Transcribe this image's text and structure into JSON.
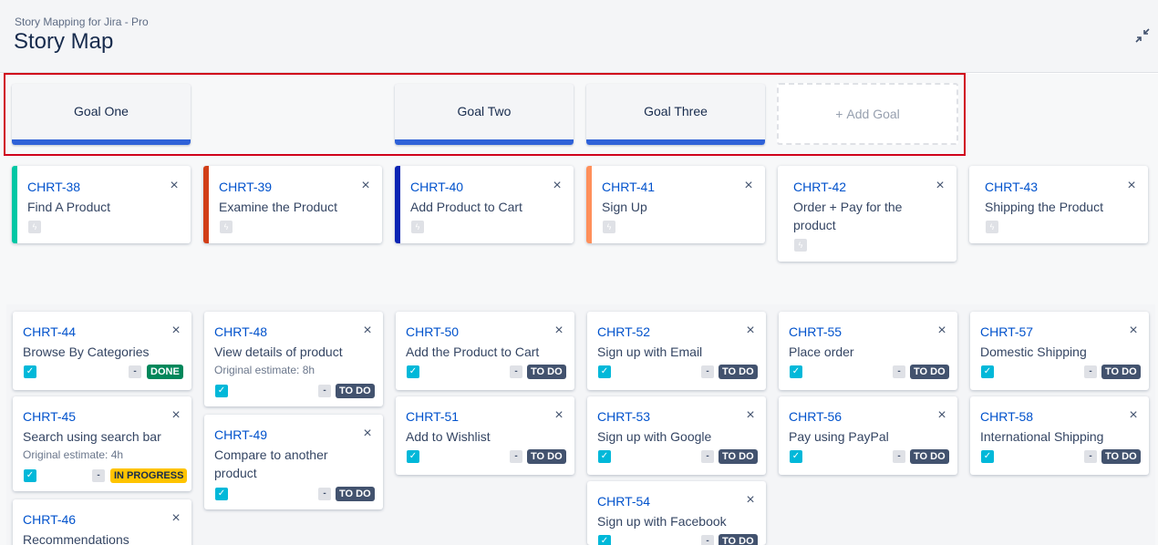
{
  "header": {
    "app_name": "Story Mapping for Jira - Pro",
    "title": "Story Map",
    "collapse_icon": "collapse-arrows-icon"
  },
  "goals": [
    {
      "label": "Goal One"
    },
    {
      "label": "Goal Two"
    },
    {
      "label": "Goal Three"
    }
  ],
  "add_goal": {
    "icon": "+",
    "label": "Add Goal"
  },
  "colors": {
    "goal_bar": "#2f62d8",
    "highlight": "#d0021b",
    "link": "#0052cc",
    "done": "#00875a",
    "todo": "#42526e",
    "in_progress": "#ffc400"
  },
  "epics": [
    {
      "key": "CHRT-38",
      "summary": "Find A Product",
      "color": "#00c7a4"
    },
    {
      "key": "CHRT-39",
      "summary": "Examine the Product",
      "color": "#d13e17"
    },
    {
      "key": "CHRT-40",
      "summary": "Add Product to Cart",
      "color": "#0a24b3"
    },
    {
      "key": "CHRT-41",
      "summary": "Sign Up",
      "color": "#ff8f5a"
    },
    {
      "key": "CHRT-42",
      "summary": "Order + Pay for the product",
      "color": ""
    },
    {
      "key": "CHRT-43",
      "summary": "Shipping the Product",
      "color": ""
    }
  ],
  "stories": {
    "estimate_chip": "-",
    "s44": {
      "key": "CHRT-44",
      "summary": "Browse By Categories",
      "status": "DONE"
    },
    "s45": {
      "key": "CHRT-45",
      "summary": "Search using search bar",
      "estimate": "Original estimate: 4h",
      "status": "IN PROGRESS"
    },
    "s46": {
      "key": "CHRT-46",
      "summary": "Recommendations"
    },
    "s48": {
      "key": "CHRT-48",
      "summary": "View details of product",
      "estimate": "Original estimate: 8h",
      "status": "TO DO"
    },
    "s49": {
      "key": "CHRT-49",
      "summary": "Compare to another product",
      "status": "TO DO"
    },
    "s50": {
      "key": "CHRT-50",
      "summary": "Add the Product to Cart",
      "status": "TO DO"
    },
    "s51": {
      "key": "CHRT-51",
      "summary": "Add to Wishlist",
      "status": "TO DO"
    },
    "s52": {
      "key": "CHRT-52",
      "summary": "Sign up with Email",
      "status": "TO DO"
    },
    "s53": {
      "key": "CHRT-53",
      "summary": "Sign up with Google",
      "status": "TO DO"
    },
    "s54": {
      "key": "CHRT-54",
      "summary": "Sign up with Facebook",
      "status": "TO DO"
    },
    "s55": {
      "key": "CHRT-55",
      "summary": "Place order",
      "status": "TO DO"
    },
    "s56": {
      "key": "CHRT-56",
      "summary": "Pay using PayPal",
      "status": "TO DO"
    },
    "s57": {
      "key": "CHRT-57",
      "summary": "Domestic Shipping",
      "status": "TO DO"
    },
    "s58": {
      "key": "CHRT-58",
      "summary": "International Shipping",
      "status": "TO DO"
    }
  },
  "icons": {
    "close": "×",
    "check": "✓",
    "epic_type": "ϟ"
  }
}
